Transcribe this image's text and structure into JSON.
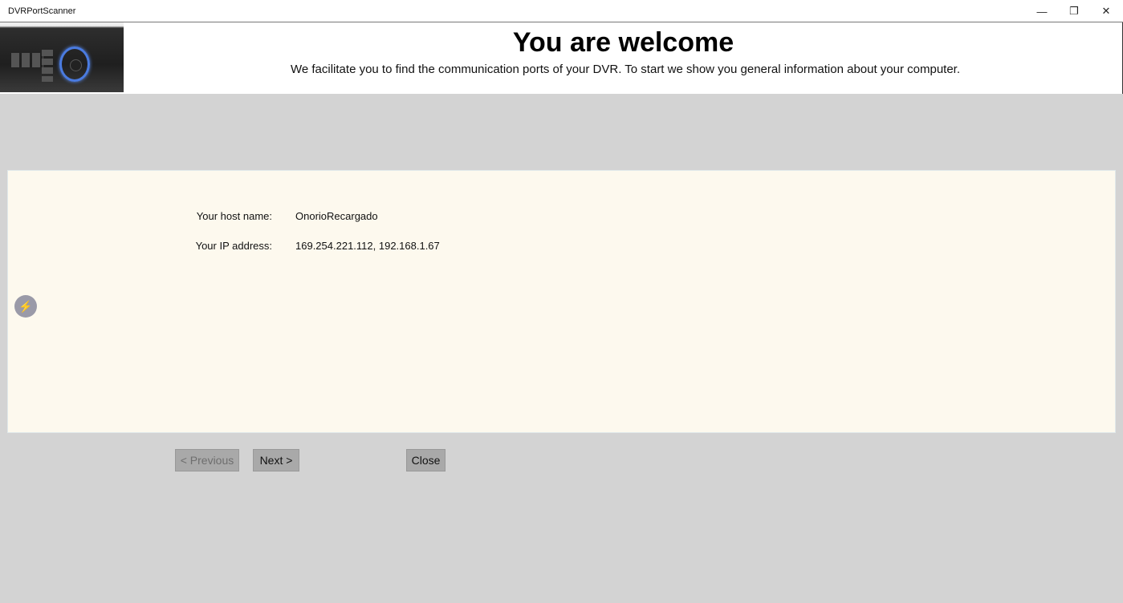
{
  "window": {
    "title": "DVRPortScanner",
    "minimize": "—",
    "restore": "❐",
    "close": "✕"
  },
  "header": {
    "title": "You are welcome",
    "subtitle": "We facilitate you to find the communication ports of your DVR. To start we show you general information about your computer."
  },
  "info": {
    "host_label": "Your host name:",
    "host_value": "OnorioRecargado",
    "ip_label": "Your IP address:",
    "ip_value": "169.254.221.112, 192.168.1.67"
  },
  "icons": {
    "bolt": "⚡"
  },
  "buttons": {
    "previous": "< Previous",
    "next": "Next >",
    "close": "Close"
  }
}
